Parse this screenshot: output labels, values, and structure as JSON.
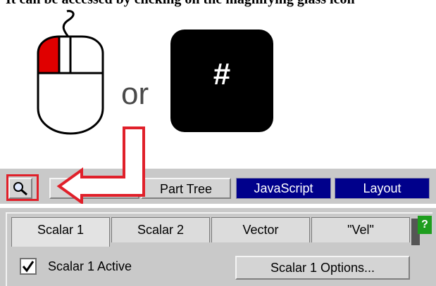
{
  "caption": {
    "text": "It can be accessed by clicking on the magnifying glass icon"
  },
  "illustration": {
    "or_text": "or",
    "hash_key_label": "#",
    "mouse_icon": "mouse-left-click-icon",
    "arrow_icon": "red-arrow-icon"
  },
  "toolbar": {
    "search_icon": "magnifying-glass-icon",
    "buttons": [
      {
        "label": "Part Tree",
        "style": "grey"
      },
      {
        "label": "JavaScript",
        "style": "blue"
      },
      {
        "label": "Layout",
        "style": "blue"
      }
    ]
  },
  "panel": {
    "tabs": [
      {
        "label": "Scalar 1",
        "active": true
      },
      {
        "label": "Scalar 2",
        "active": false
      },
      {
        "label": "Vector",
        "active": false
      },
      {
        "label": "\"Vel\"",
        "active": false
      }
    ],
    "help_label": "?",
    "checkbox": {
      "label": "Scalar 1 Active",
      "checked": true
    },
    "options_button": "Scalar 1 Options..."
  },
  "colors": {
    "highlight": "#e0202a",
    "toolbar_blue": "#00008b",
    "help_green": "#1e9e1e",
    "panel_grey": "#c9c9c9"
  }
}
